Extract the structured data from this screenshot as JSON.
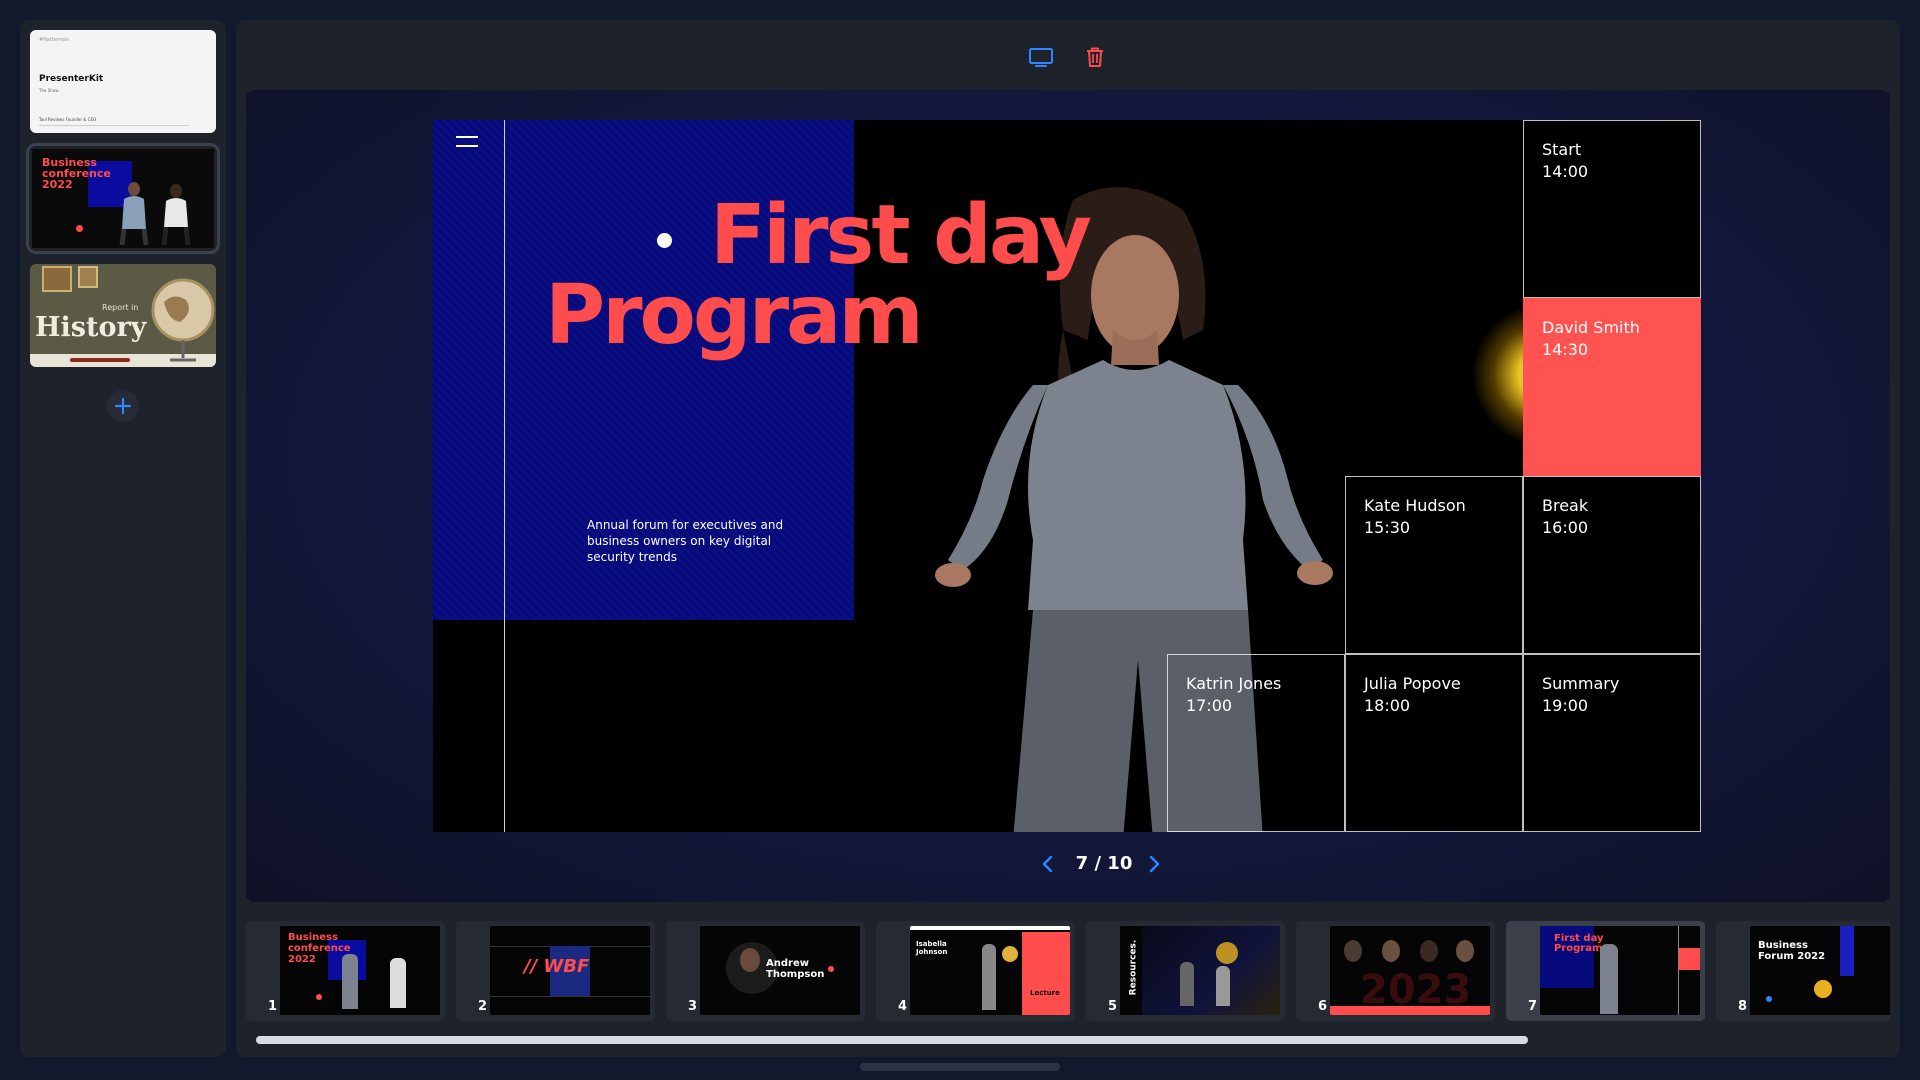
{
  "sidebar": {
    "decks": [
      {
        "tag": "#Nattemals",
        "title": "PresenterKit",
        "subtitle": "The Shaw",
        "footer": "Tool Reviews Founder & CEO"
      },
      {
        "title": "Business conference 2022"
      },
      {
        "title": "History",
        "subtitle": "Report in"
      }
    ],
    "add_icon": "plus-icon"
  },
  "toolbar": {
    "present_icon": "monitor-icon",
    "delete_icon": "trash-icon"
  },
  "slide": {
    "title_line1": "First day",
    "title_line2": "Program",
    "description": "Annual forum for executives and business owners on key digital security trends",
    "schedule": [
      {
        "name": "Start",
        "time": "14:00"
      },
      {
        "name": "David Smith",
        "time": "14:30"
      },
      {
        "name": "Kate Hudson",
        "time": "15:30"
      },
      {
        "name": "Break",
        "time": "16:00"
      },
      {
        "name": "Katrin Jones",
        "time": "17:00"
      },
      {
        "name": "Julia Popove",
        "time": "18:00"
      },
      {
        "name": "Summary",
        "time": "19:00"
      }
    ]
  },
  "pager": {
    "label": "7 / 10",
    "prev_icon": "chevron-left-icon",
    "next_icon": "chevron-right-icon"
  },
  "filmstrip": [
    {
      "num": "1",
      "text": "Business conference 2022"
    },
    {
      "num": "2",
      "text": "// WBF"
    },
    {
      "num": "3",
      "text": "Andrew Thompson"
    },
    {
      "num": "4",
      "text": "Isabella Johnson",
      "extra": "Lecture"
    },
    {
      "num": "5",
      "text": "Resources."
    },
    {
      "num": "6",
      "text": "2023"
    },
    {
      "num": "7",
      "text": "First day Program"
    },
    {
      "num": "8",
      "text": "Business Forum 2022"
    }
  ],
  "colors": {
    "accent": "#ff4c4c",
    "brand_blue": "#070a7c",
    "icon_blue": "#2f86ff",
    "delete_red": "#ff4a4a"
  }
}
